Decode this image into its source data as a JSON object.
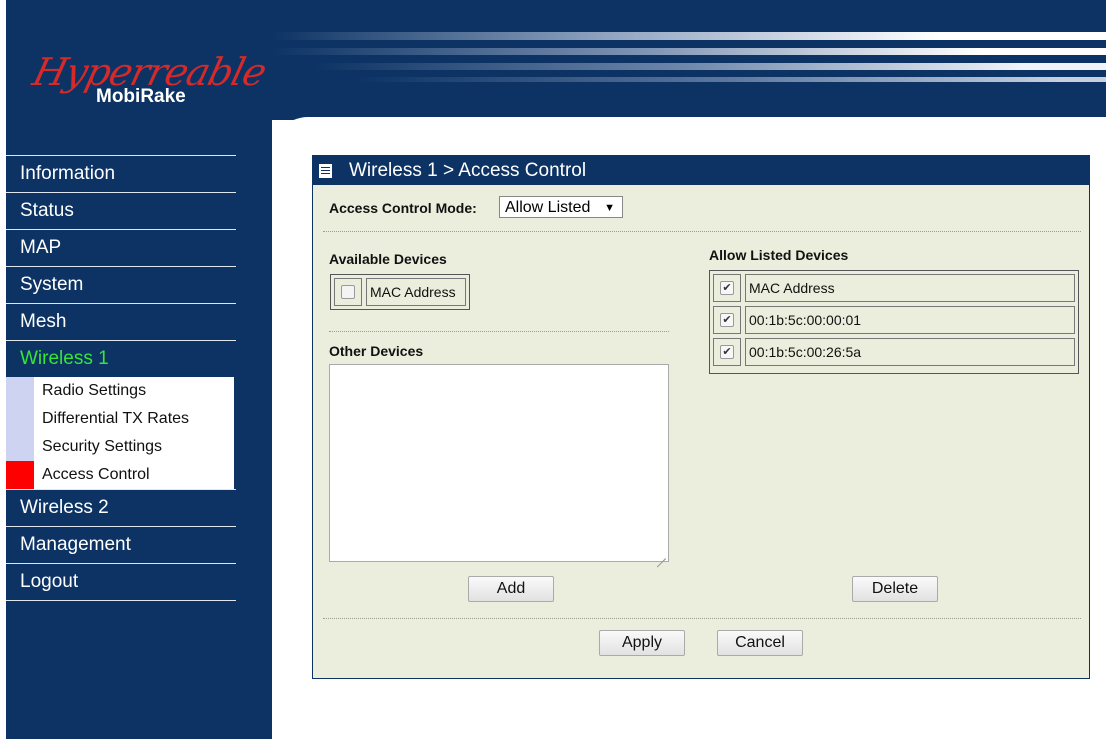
{
  "brand": {
    "script": "Hyperreable",
    "name": "MobiRake",
    "accent": "#d42a2a"
  },
  "nav": {
    "items": [
      {
        "label": "Information"
      },
      {
        "label": "Status"
      },
      {
        "label": "MAP"
      },
      {
        "label": "System"
      },
      {
        "label": "Mesh"
      },
      {
        "label": "Wireless 1",
        "active": true
      }
    ],
    "submenu": [
      {
        "label": "Radio Settings"
      },
      {
        "label": "Differential TX Rates"
      },
      {
        "label": "Security Settings"
      },
      {
        "label": "Access Control",
        "selected": true
      }
    ],
    "items_after": [
      {
        "label": "Wireless 2"
      },
      {
        "label": "Management"
      },
      {
        "label": "Logout"
      }
    ]
  },
  "panel": {
    "title": "Wireless 1 > Access Control",
    "mode_label": "Access Control Mode:",
    "mode_value": "Allow Listed",
    "available_label": "Available Devices",
    "available_header": "MAC Address",
    "other_label": "Other Devices",
    "other_value": "",
    "allowed_label": "Allow Listed Devices",
    "allowed_header": "MAC Address",
    "allowed_devices": [
      "00:1b:5c:00:00:01",
      "00:1b:5c:00:26:5a"
    ],
    "add_label": "Add",
    "delete_label": "Delete",
    "apply_label": "Apply",
    "cancel_label": "Cancel"
  },
  "colors": {
    "navy": "#0c3364",
    "panel_bg": "#ebeedd",
    "active_nav": "#36e536",
    "selected_marker": "#ff0000"
  },
  "icons": {
    "panel_icon": "document-icon",
    "dropdown": "triangle-down-icon",
    "check": "checkmark"
  }
}
